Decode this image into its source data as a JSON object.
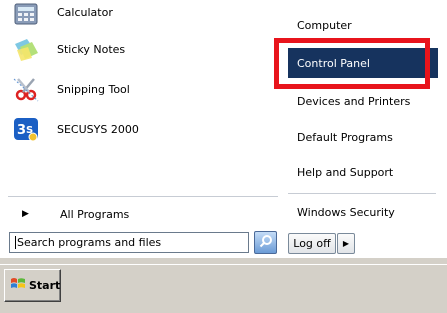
{
  "left_pane": {
    "programs": [
      {
        "label": "Calculator",
        "icon": "calculator-icon"
      },
      {
        "label": "Sticky Notes",
        "icon": "sticky-notes-icon"
      },
      {
        "label": "Snipping Tool",
        "icon": "snipping-tool-icon"
      },
      {
        "label": "SECUSYS 2000",
        "icon": "secusys-icon"
      }
    ],
    "all_programs": {
      "label": "All Programs",
      "arrow": "▶"
    },
    "search": {
      "value": "",
      "placeholder": "Search programs and files"
    }
  },
  "right_pane": {
    "items": [
      {
        "label": "Computer"
      },
      {
        "label": "Control Panel"
      },
      {
        "label": "Devices and Printers"
      },
      {
        "label": "Default Programs"
      },
      {
        "label": "Help and Support"
      },
      {
        "label": "Windows Security"
      }
    ],
    "logoff": {
      "label": "Log off",
      "arrow": "▶"
    }
  },
  "taskbar": {
    "start_label": "Start"
  },
  "colors": {
    "selected_bg": "#16335e",
    "highlight_frame": "#e8141c",
    "taskbar": "#d4d0c8"
  }
}
